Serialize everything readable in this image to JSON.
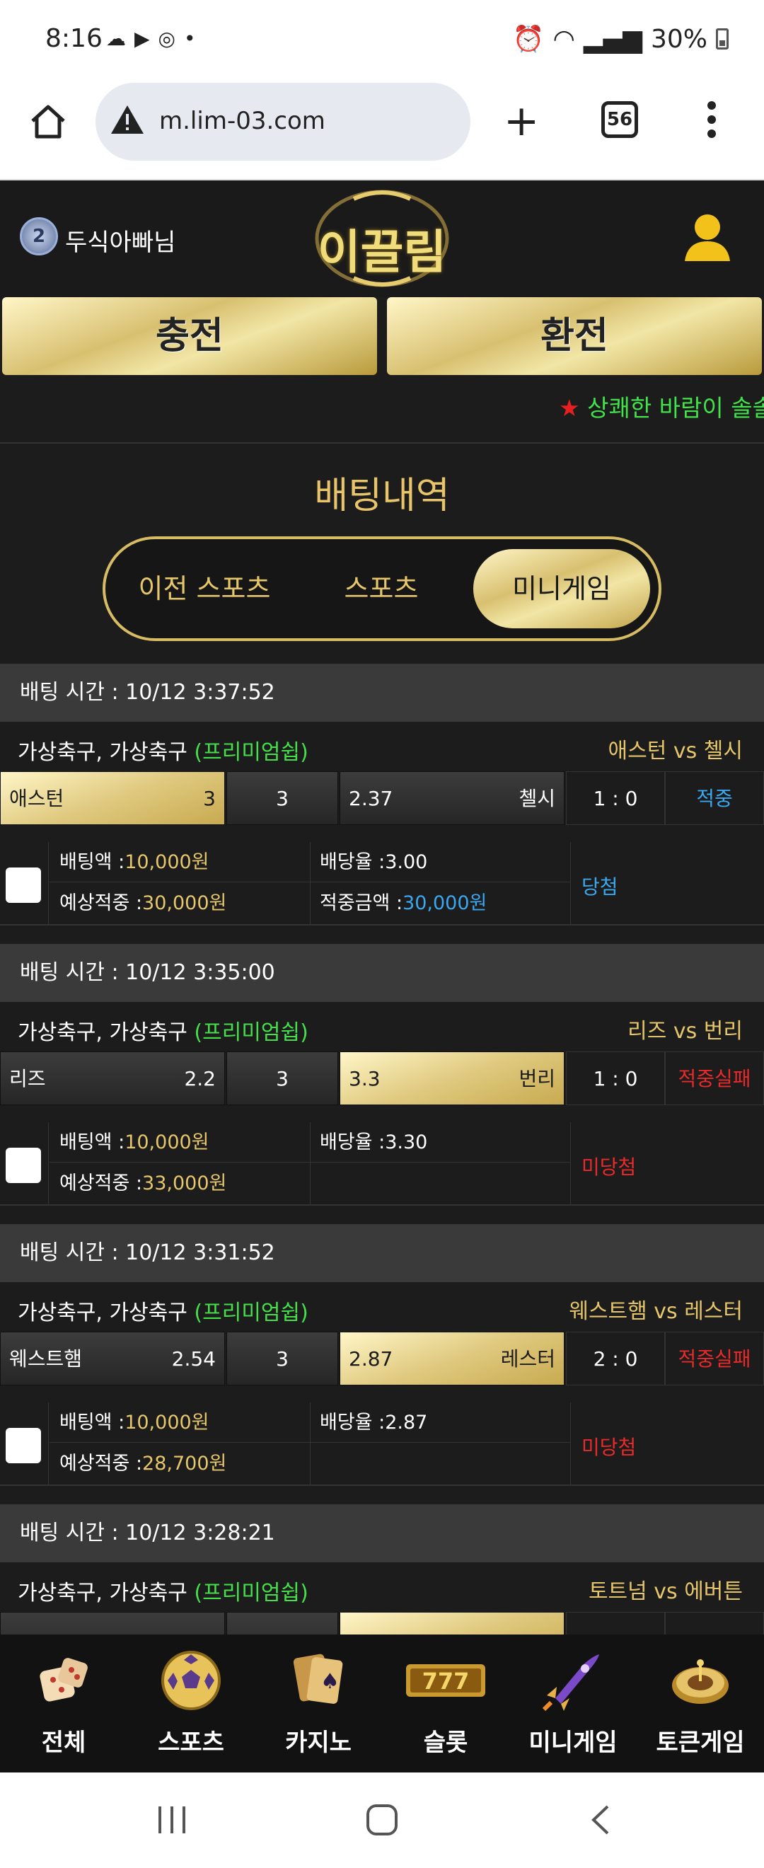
{
  "status_bar": {
    "time": "8:16",
    "battery": "30%"
  },
  "browser": {
    "url": "m.lim-03.com",
    "tab_count": "56"
  },
  "header": {
    "username": "두식아빠님",
    "level": "2",
    "logo_text": "이끌림"
  },
  "actions": {
    "deposit": "충전",
    "withdraw": "환전"
  },
  "ticker": "상쾌한 바람이 솔솔",
  "page_title": "배팅내역",
  "tabs": [
    {
      "label": "이전 스포츠",
      "active": false
    },
    {
      "label": "스포츠",
      "active": false
    },
    {
      "label": "미니게임",
      "active": true
    }
  ],
  "labels": {
    "bet_amount": "배팅액 :",
    "odds": "배당율 :",
    "expected": "예상적중 :",
    "win_amount": "적중금액 :",
    "premium": "(프리미엄쉽)"
  },
  "bets": [
    {
      "time": "배팅 시간 : 10/12 3:37:52",
      "league": "가상축구, 가상축구",
      "match": "애스턴  vs  첼시",
      "home": "애스턴",
      "home_odds": "3",
      "draw": "3",
      "away_odds": "2.37",
      "away": "첼시",
      "selected": "home",
      "score": "1 : 0",
      "status": "적중",
      "status_type": "win",
      "amount": "10,000원",
      "rate": "3.00",
      "expected": "30,000원",
      "win_amount": "30,000원",
      "result": "당첨",
      "result_type": "win"
    },
    {
      "time": "배팅 시간 : 10/12 3:35:00",
      "league": "가상축구, 가상축구",
      "match": "리즈  vs  번리",
      "home": "리즈",
      "home_odds": "2.2",
      "draw": "3",
      "away_odds": "3.3",
      "away": "번리",
      "selected": "away",
      "score": "1 : 0",
      "status": "적중실패",
      "status_type": "lose",
      "amount": "10,000원",
      "rate": "3.30",
      "expected": "33,000원",
      "win_amount": "",
      "result": "미당첨",
      "result_type": "lose"
    },
    {
      "time": "배팅 시간 : 10/12 3:31:52",
      "league": "가상축구, 가상축구",
      "match": "웨스트햄  vs  레스터",
      "home": "웨스트햄",
      "home_odds": "2.54",
      "draw": "3",
      "away_odds": "2.87",
      "away": "레스터",
      "selected": "away",
      "score": "2 : 0",
      "status": "적중실패",
      "status_type": "lose",
      "amount": "10,000원",
      "rate": "2.87",
      "expected": "28,700원",
      "win_amount": "",
      "result": "미당첨",
      "result_type": "lose"
    },
    {
      "time": "배팅 시간 : 10/12 3:28:21",
      "league": "가상축구, 가상축구",
      "match": "토트넘  vs  에버튼"
    }
  ],
  "bottom_nav": [
    {
      "label": "전체",
      "icon": "dice-icon"
    },
    {
      "label": "스포츠",
      "icon": "soccer-ball-icon"
    },
    {
      "label": "카지노",
      "icon": "cards-icon"
    },
    {
      "label": "슬롯",
      "icon": "slot-777-icon"
    },
    {
      "label": "미니게임",
      "icon": "rocket-icon"
    },
    {
      "label": "토큰게임",
      "icon": "roulette-icon"
    }
  ]
}
